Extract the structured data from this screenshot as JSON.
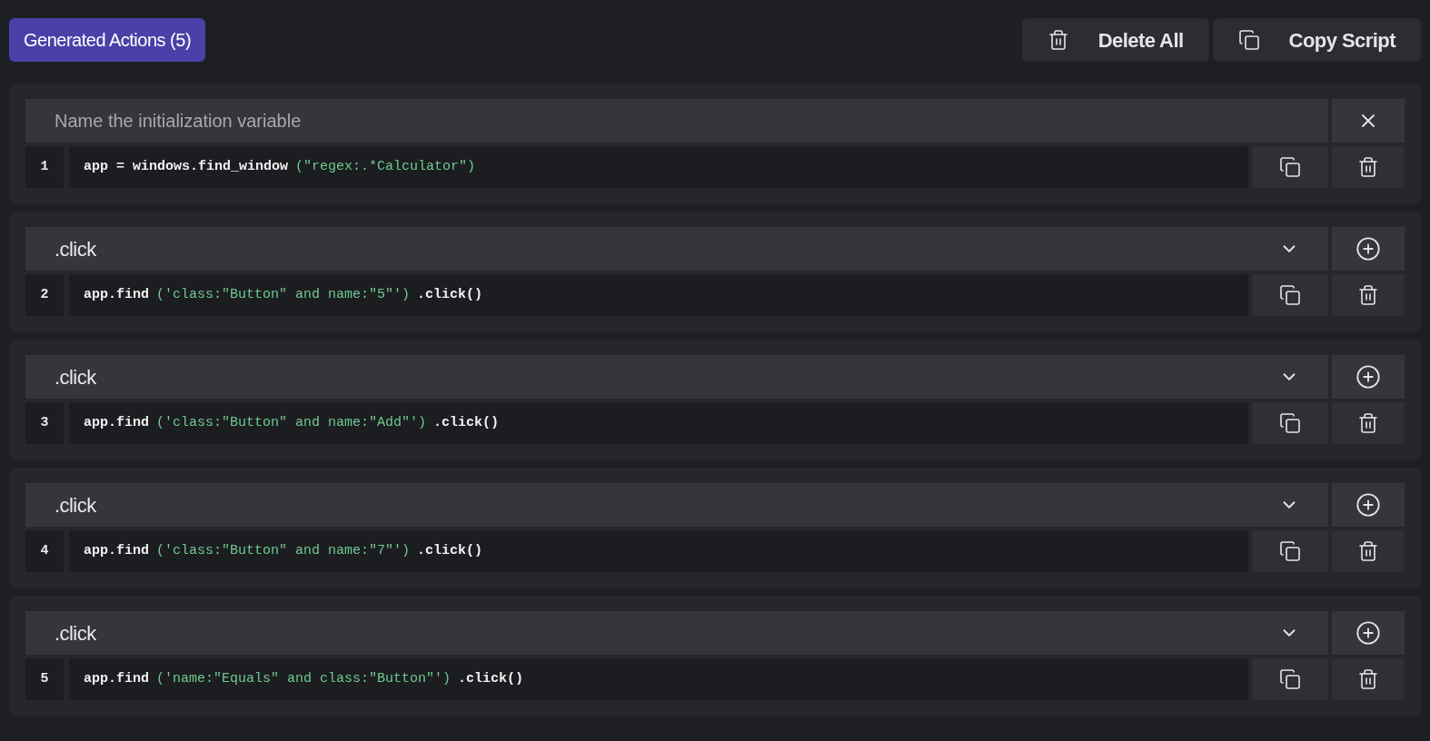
{
  "header": {
    "title": "Generated Actions (5)",
    "buttons": [
      {
        "kind": "delete",
        "label": "Delete All"
      },
      {
        "kind": "copy",
        "label": "Copy Script"
      }
    ]
  },
  "actions": [
    {
      "kind": "input",
      "placeholder": "Name the initialization variable",
      "line": "1",
      "code": [
        {
          "kind": "plain",
          "text": "app = windows.find_window"
        },
        {
          "kind": "string",
          "text": "(\"regex:.*Calculator\")"
        }
      ]
    },
    {
      "kind": "action",
      "title": ".click",
      "line": "2",
      "code": [
        {
          "kind": "plain",
          "text": "app.find"
        },
        {
          "kind": "string",
          "text": "('class:\"Button\" and name:\"5\"')"
        },
        {
          "kind": "plain",
          "text": ".click()"
        }
      ]
    },
    {
      "kind": "action",
      "title": ".click",
      "line": "3",
      "code": [
        {
          "kind": "plain",
          "text": "app.find"
        },
        {
          "kind": "string",
          "text": "('class:\"Button\" and name:\"Add\"')"
        },
        {
          "kind": "plain",
          "text": ".click()"
        }
      ]
    },
    {
      "kind": "action",
      "title": ".click",
      "line": "4",
      "code": [
        {
          "kind": "plain",
          "text": "app.find"
        },
        {
          "kind": "string",
          "text": "('class:\"Button\" and name:\"7\"')"
        },
        {
          "kind": "plain",
          "text": ".click()"
        }
      ]
    },
    {
      "kind": "action",
      "title": ".click",
      "line": "5",
      "code": [
        {
          "kind": "plain",
          "text": "app.find"
        },
        {
          "kind": "string",
          "text": "('name:\"Equals\" and class:\"Button\"')"
        },
        {
          "kind": "plain",
          "text": ".click()"
        }
      ]
    }
  ]
}
